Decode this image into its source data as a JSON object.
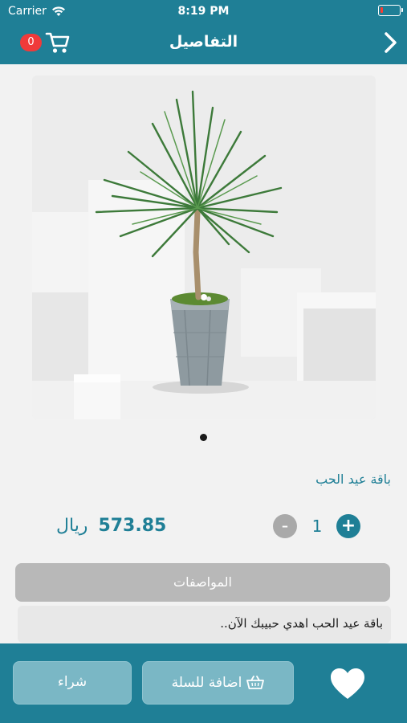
{
  "status_bar": {
    "carrier": "Carrier",
    "time": "8:19 PM"
  },
  "nav": {
    "title": "التفاصيل",
    "cart_count": "0"
  },
  "product": {
    "name": "باقة عيد الحب",
    "price_value": "573.85",
    "price_currency": "ريال",
    "quantity": "1",
    "minus_label": "-",
    "plus_label": "+"
  },
  "specs": {
    "header": "المواصفات",
    "description": "باقة عيد الحب اهدي حبيبك الآن.."
  },
  "actions": {
    "buy_label": "شراء",
    "add_to_cart_label": "اضافة للسلة"
  },
  "colors": {
    "primary": "#1f7f96",
    "badge": "#f03a3a",
    "button_bg": "#7ab7c5"
  }
}
